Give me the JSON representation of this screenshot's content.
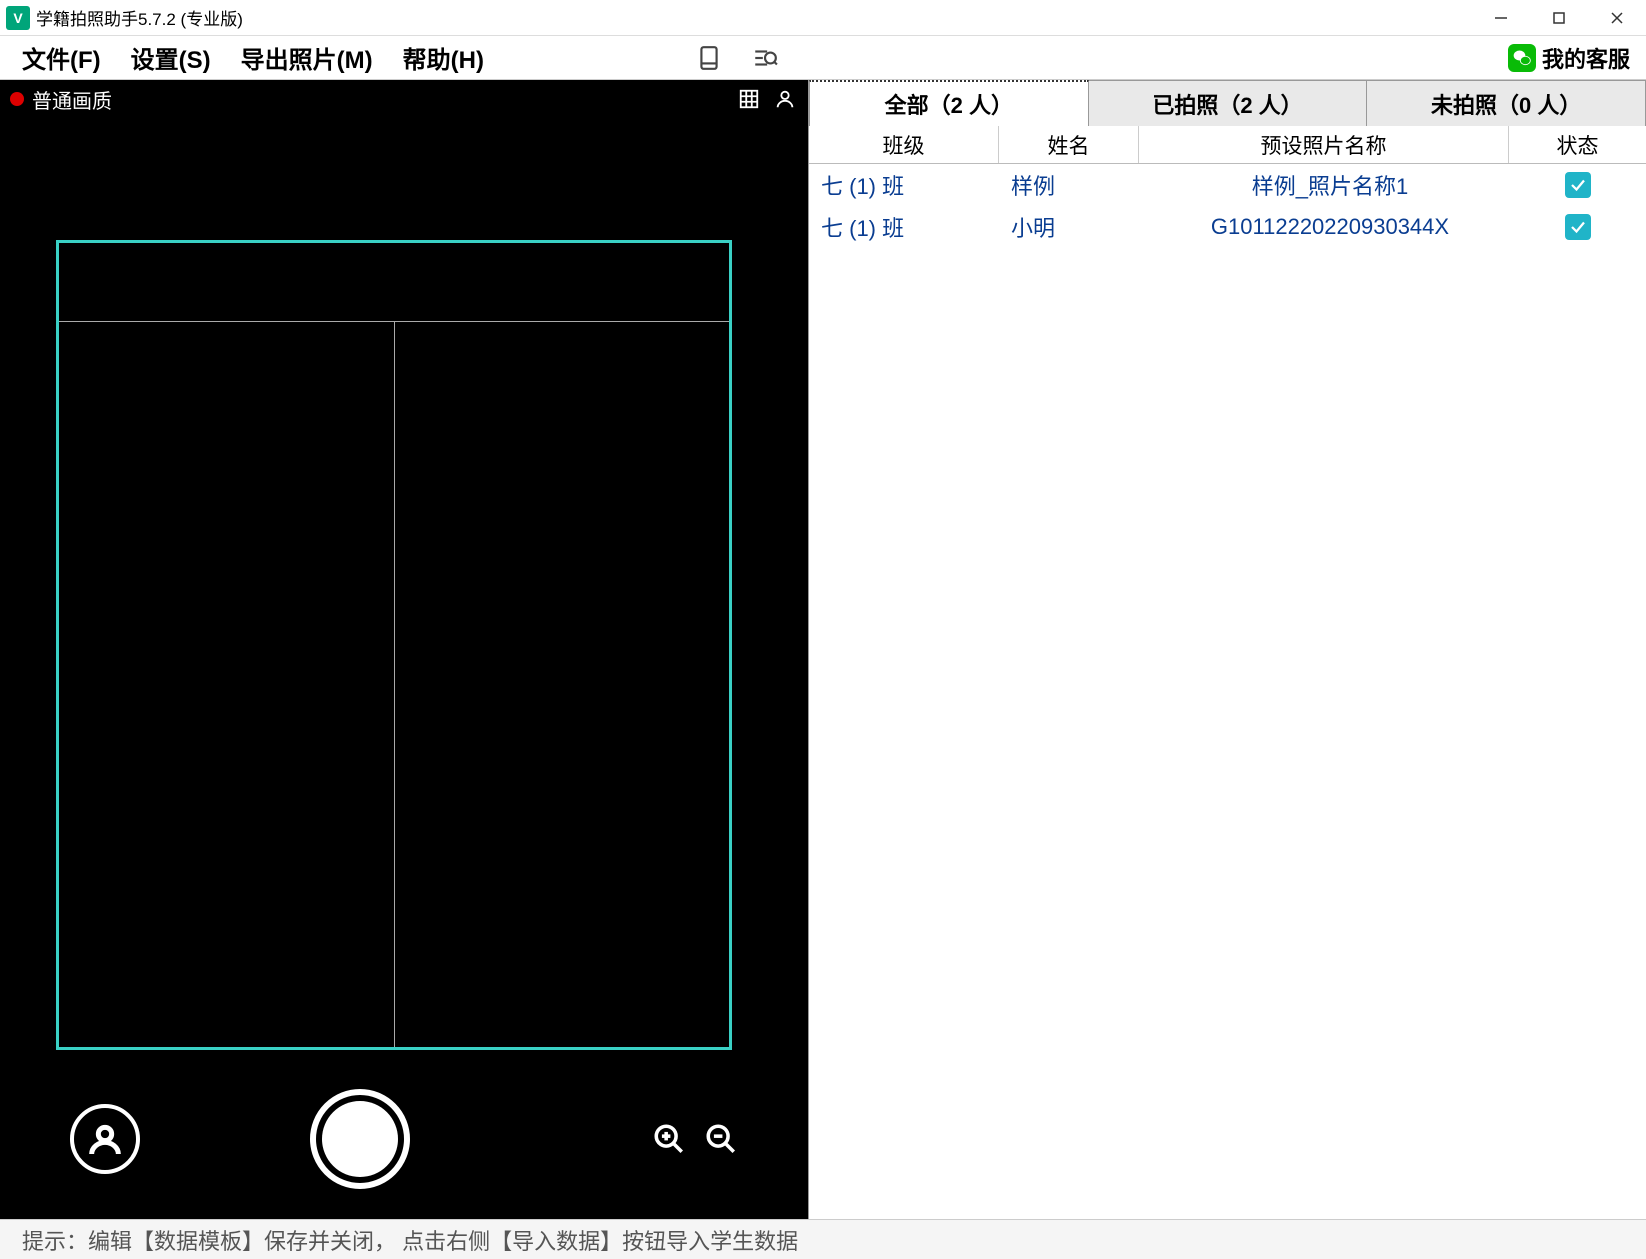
{
  "app": {
    "icon_letter": "V",
    "title": "学籍拍照助手5.7.2 (专业版)"
  },
  "menu": {
    "file": "文件(F)",
    "settings": "设置(S)",
    "export": "导出照片(M)",
    "help": "帮助(H)"
  },
  "support": {
    "label": "我的客服"
  },
  "camera": {
    "quality": "普通画质"
  },
  "tabs": {
    "all": "全部（2 人）",
    "taken": "已拍照（2 人）",
    "nottaken": "未拍照（0 人）"
  },
  "table": {
    "headers": {
      "class": "班级",
      "name": "姓名",
      "preset": "预设照片名称",
      "status": "状态"
    },
    "rows": [
      {
        "class": "七 (1) 班",
        "name": "样例",
        "preset": "样例_照片名称1",
        "status": true
      },
      {
        "class": "七 (1) 班",
        "name": "小明",
        "preset": "G10112220220930344X",
        "status": true
      }
    ]
  },
  "statusbar": {
    "text": "提示：编辑【数据模板】保存并关闭， 点击右侧【导入数据】按钮导入学生数据"
  }
}
